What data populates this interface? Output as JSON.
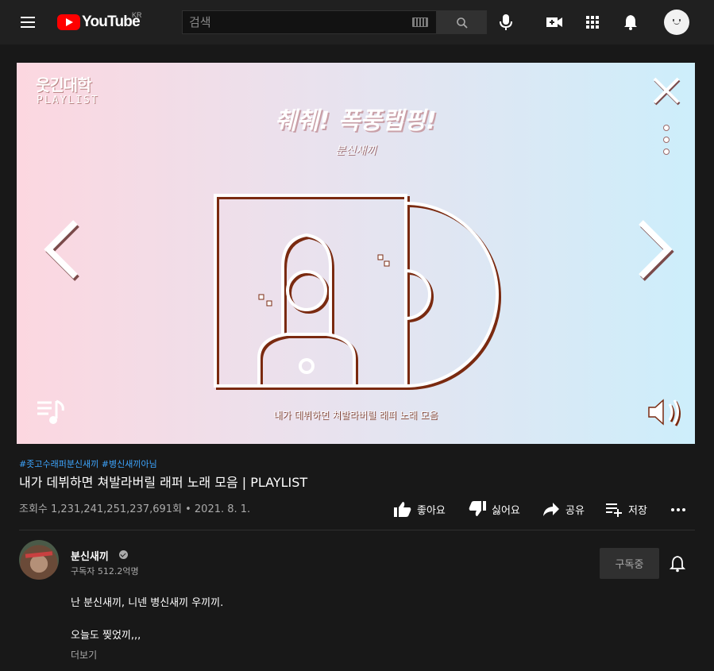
{
  "header": {
    "logo_text": "YouTube",
    "country_code": "KR",
    "search_placeholder": "검색"
  },
  "player": {
    "brand": "웃긴대학",
    "brand_sub": "PLAYLIST",
    "title": "췌췌! 폭풍랩핑!",
    "artist": "분신새끼",
    "caption": "내가 데뷔하면 쳐발라버릴 래퍼 노래 모음"
  },
  "video": {
    "hashtags": [
      "#좃고수래퍼분신새끼",
      "#병신새끼아님"
    ],
    "title": "내가 데뷔하면 쳐발라버릴 래퍼 노래 모음 | PLAYLIST",
    "meta": "조회수 1,231,241,251,237,691회 • 2021. 8. 1."
  },
  "actions": {
    "like": "좋아요",
    "dislike": "싫어요",
    "share": "공유",
    "save": "저장"
  },
  "channel": {
    "name": "분신새끼",
    "subscribers": "구독자 512.2억명",
    "subscribe_label": "구독중"
  },
  "description": {
    "line1": "난 분신새끼, 니넨 병신새끼 우끼끼.",
    "line2": "오늘도 찢었끼,,,",
    "more": "더보기"
  },
  "colors": {
    "background": "#181818",
    "header": "#202020",
    "link": "#3ea6ff",
    "brand_red": "#ff0000"
  }
}
